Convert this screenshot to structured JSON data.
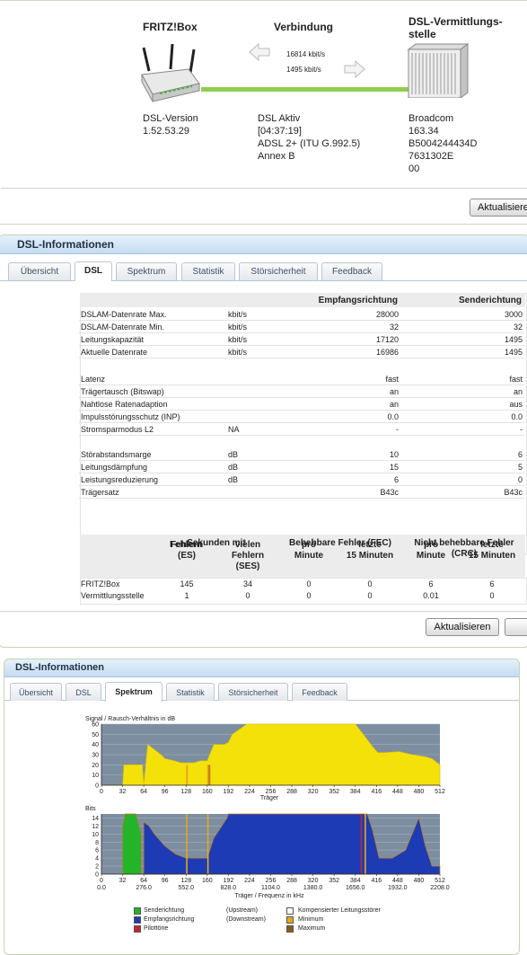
{
  "overview": {
    "fritzbox_title": "FRITZ!Box",
    "connection_title": "Verbindung",
    "dslam_title_1": "DSL-Vermittlungs-",
    "dslam_title_2": "stelle",
    "rate_down": "16814 kbit/s",
    "rate_up": "1495 kbit/s",
    "version_label": "DSL-Version",
    "version_value": "1.52.53.29",
    "status_1": "DSL Aktiv",
    "status_2": "[04:37:19]",
    "status_3": "ADSL 2+ (ITU G.992.5)",
    "status_4": "Annex B",
    "dslam_1": "Broadcom",
    "dslam_2": "163.34",
    "dslam_3": "B5004244434D",
    "dslam_4": "7631302E",
    "dslam_5": "00",
    "refresh": "Aktualisieren"
  },
  "dsl_panel": {
    "title": "DSL-Informationen",
    "tabs": [
      "Übersicht",
      "DSL",
      "Spektrum",
      "Statistik",
      "Störsicherheit",
      "Feedback"
    ],
    "col_down": "Empfangsrichtung",
    "col_up": "Senderichtung",
    "rows": [
      {
        "label": "DSLAM-Datenrate Max.",
        "unit": "kbit/s",
        "down": "28000",
        "up": "3000"
      },
      {
        "label": "DSLAM-Datenrate Min.",
        "unit": "kbit/s",
        "down": "32",
        "up": "32"
      },
      {
        "label": "Leitungskapazität",
        "unit": "kbit/s",
        "down": "17120",
        "up": "1495"
      },
      {
        "label": "Aktuelle Datenrate",
        "unit": "kbit/s",
        "down": "16986",
        "up": "1495"
      },
      {
        "label": "Latenz",
        "unit": "",
        "down": "fast",
        "up": "fast"
      },
      {
        "label": "Trägertausch (Bitswap)",
        "unit": "",
        "down": "an",
        "up": "an"
      },
      {
        "label": "Nahtlose Ratenadaption",
        "unit": "",
        "down": "an",
        "up": "aus"
      },
      {
        "label": "Impulsstörungsschutz (INP)",
        "unit": "",
        "down": "0.0",
        "up": "0.0"
      },
      {
        "label": "Stromsparmodus L2",
        "unit": "NA",
        "down": "-",
        "up": "-"
      },
      {
        "label": "Störabstandsmarge",
        "unit": "dB",
        "down": "10",
        "up": "6"
      },
      {
        "label": "Leitungsdämpfung",
        "unit": "dB",
        "down": "15",
        "up": "5"
      },
      {
        "label": "Leistungsreduzierung",
        "unit": "dB",
        "down": "6",
        "up": "0"
      },
      {
        "label": "Trägersatz",
        "unit": "",
        "down": "B43c",
        "up": "B43c"
      }
    ],
    "err_head_sec": "Sekunden mit",
    "err_head_fec": "Behebbare Fehler (FEC)",
    "err_head_crc_1": "Nicht behebbare Fehler",
    "err_head_crc_2": "(CRC)",
    "sub_es_1": "Fehlern",
    "sub_es_2": "(ES)",
    "sub_ses_1": "vielen",
    "sub_ses_2": "Fehlern",
    "sub_ses_3": "(SES)",
    "sub_pro_1": "pro",
    "sub_pro_2": "Minute",
    "sub_15_1": "letzte",
    "sub_15_2": "15 Minuten",
    "err_rows": [
      {
        "label": "FRITZ!Box",
        "es": "145",
        "ses": "34",
        "fec_min": "0",
        "fec_15": "0",
        "crc_min": "6",
        "crc_15": "6"
      },
      {
        "label": "Vermittlungsstelle",
        "es": "1",
        "ses": "0",
        "fec_min": "0",
        "fec_15": "0",
        "crc_min": "0.01",
        "crc_15": "0"
      }
    ],
    "refresh": "Aktualisieren"
  },
  "spectrum_panel": {
    "title": "DSL-Informationen",
    "tabs": [
      "Übersicht",
      "DSL",
      "Spektrum",
      "Statistik",
      "Störsicherheit",
      "Feedback"
    ],
    "snr_title": "Signal / Rausch-Verhältnis in dB",
    "snr_yticks": [
      "60",
      "50",
      "40",
      "30",
      "20",
      "10",
      "0"
    ],
    "xticks": [
      "0",
      "32",
      "64",
      "96",
      "128",
      "160",
      "192",
      "224",
      "256",
      "288",
      "320",
      "352",
      "384",
      "416",
      "448",
      "480",
      "512"
    ],
    "xlabel1": "Träger",
    "bits_title": "Bits",
    "bits_yticks": [
      "14",
      "12",
      "10",
      "8",
      "6",
      "4",
      "2",
      "0"
    ],
    "freq_ticks": [
      "0.0",
      "276.0",
      "552.0",
      "828.0",
      "1104.0",
      "1380.0",
      "1656.0",
      "1932.0",
      "2208.0"
    ],
    "xlabel2": "Träger / Frequenz in kHz",
    "legend": [
      {
        "label": "Senderichtung",
        "note": "(Upstream)",
        "color": "#22b52a"
      },
      {
        "label": "Empfangsrichtung",
        "note": "(Downstream)",
        "color": "#1d3bb5"
      },
      {
        "label": "Pilottöne",
        "note": "",
        "color": "#c0262d"
      }
    ],
    "legend_right": [
      {
        "label": "Kompensierter Leitungsstörer",
        "color": "#ffffff"
      },
      {
        "label": "Minimum",
        "color": "#e6a817"
      },
      {
        "label": "Maximum",
        "color": "#8a5a1a"
      }
    ]
  },
  "chart_data": [
    {
      "type": "area",
      "title": "Signal / Rausch-Verhältnis in dB",
      "xlabel": "Träger",
      "ylabel": "",
      "xlim": [
        0,
        512
      ],
      "ylim": [
        0,
        60
      ],
      "series": [
        {
          "x": [
            0,
            32,
            34,
            62,
            64,
            70,
            90,
            96,
            110,
            120,
            128,
            140,
            150,
            160,
            170,
            186,
            192,
            198,
            220,
            240,
            270,
            300,
            330,
            360,
            376,
            384,
            396,
            410,
            418,
            430,
            450,
            470,
            490,
            500,
            512
          ],
          "y": [
            0,
            0,
            20,
            20,
            0,
            40,
            30,
            26,
            24,
            22,
            22,
            22,
            24,
            24,
            40,
            40,
            42,
            50,
            62,
            62,
            62,
            62,
            62,
            62,
            62,
            62,
            50,
            38,
            32,
            32,
            33,
            30,
            28,
            26,
            20
          ]
        }
      ]
    },
    {
      "type": "area",
      "title": "Bits",
      "xlabel": "Träger / Frequenz in kHz",
      "ylabel": "",
      "xlim": [
        0,
        512
      ],
      "ylim": [
        0,
        15
      ],
      "series": [
        {
          "name": "Senderichtung",
          "x": [
            32,
            36,
            44,
            52,
            60
          ],
          "y": [
            12,
            15,
            15,
            15,
            10
          ]
        },
        {
          "name": "Empfangsrichtung",
          "x": [
            64,
            72,
            80,
            96,
            112,
            128,
            144,
            160,
            170,
            190,
            192,
            380,
            384,
            394,
            402,
            410,
            420,
            440,
            460,
            470,
            480,
            490,
            500,
            512
          ],
          "y": [
            13,
            12,
            10,
            7,
            5,
            4,
            4,
            4,
            9,
            14,
            15,
            15,
            15,
            15,
            15,
            11,
            4,
            4,
            6,
            10,
            14,
            7,
            2,
            2
          ]
        }
      ]
    }
  ]
}
